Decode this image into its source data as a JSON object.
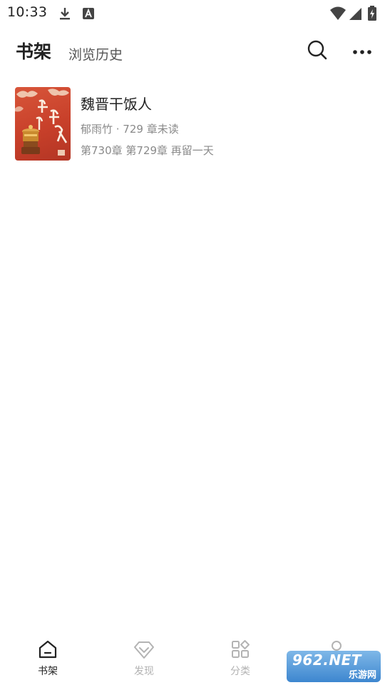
{
  "status_bar": {
    "time": "10:33",
    "icons": [
      "download-icon",
      "a-badge-icon",
      "wifi-icon",
      "signal-icon",
      "battery-icon"
    ]
  },
  "header": {
    "tabs": [
      {
        "label": "书架",
        "active": true
      },
      {
        "label": "浏览历史",
        "active": false
      }
    ],
    "actions": [
      "search-icon",
      "more-icon"
    ]
  },
  "books": [
    {
      "title": "魏晋干饭人",
      "meta": "郁雨竹 · 729 章未读",
      "progress": "第730章 第729章 再留一天",
      "cover_color": "#c8402a"
    }
  ],
  "bottom_nav": {
    "items": [
      {
        "label": "书架",
        "icon": "home-icon",
        "active": true
      },
      {
        "label": "发现",
        "icon": "diamond-icon",
        "active": false
      },
      {
        "label": "分类",
        "icon": "category-icon",
        "active": false
      },
      {
        "label": "",
        "icon": "profile-icon",
        "active": false
      }
    ]
  },
  "watermark": {
    "top": "962.NET",
    "bottom": "乐游网"
  },
  "colors": {
    "active_text": "#222222",
    "inactive_text": "#b3b3b3",
    "meta_text": "#8a8a8a"
  }
}
